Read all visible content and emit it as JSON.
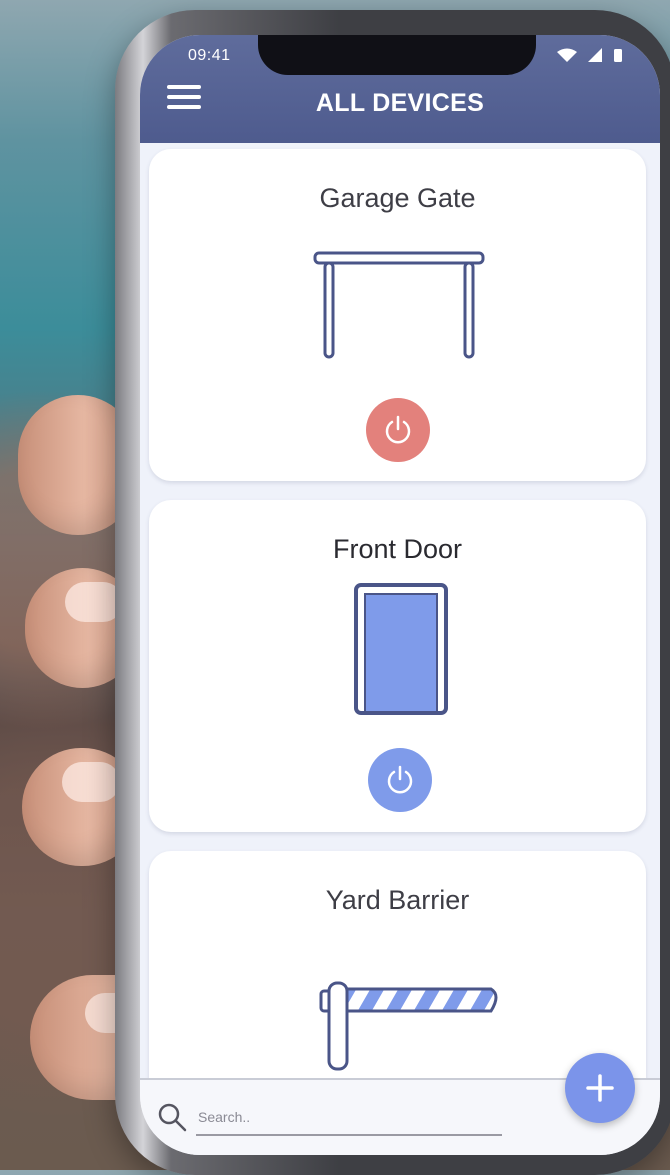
{
  "status_bar": {
    "time": "09:41"
  },
  "header": {
    "title": "ALL DEVICES",
    "menu_icon": "hamburger-menu-icon"
  },
  "devices": [
    {
      "name": "Garage Gate",
      "icon": "gate-icon",
      "power_icon": "power-icon",
      "power_color": "#e3817c"
    },
    {
      "name": "Front Door",
      "icon": "door-icon",
      "power_icon": "power-icon",
      "power_color": "#7f9bea"
    },
    {
      "name": "Yard Barrier",
      "icon": "barrier-icon"
    }
  ],
  "search": {
    "placeholder": "Search..",
    "icon": "search-icon"
  },
  "fab": {
    "icon": "plus-icon",
    "color": "#7b94ea"
  },
  "colors": {
    "header": "#55629a",
    "accent_blue": "#7f9bea",
    "accent_red": "#e3817c",
    "icon_stroke": "#4a5588"
  }
}
